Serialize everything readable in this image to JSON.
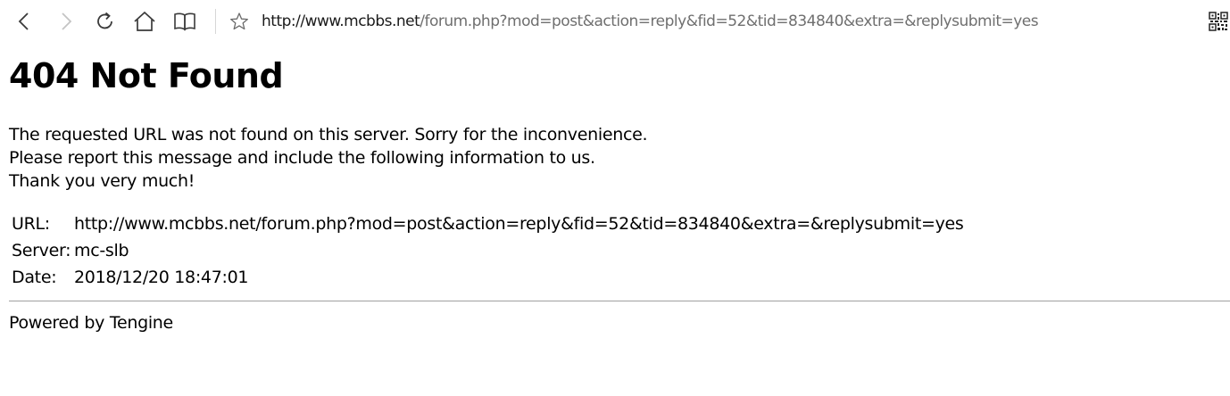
{
  "browser": {
    "address_bar": {
      "host_part": "http://www.mcbbs.net",
      "path_part": "/forum.php?mod=post&action=reply&fid=52&tid=834840&extra=&replysubmit=yes"
    },
    "icons": {
      "back": "back-arrow-icon",
      "forward": "forward-arrow-icon",
      "refresh": "refresh-icon",
      "home": "home-icon",
      "reading_view": "reading-view-book-icon",
      "favorite": "star-icon",
      "qr": "qr-code-icon"
    }
  },
  "page": {
    "heading": "404 Not Found",
    "messages": [
      "The requested URL was not found on this server. Sorry for the inconvenience.",
      "Please report this message and include the following information to us.",
      "Thank you very much!"
    ],
    "info": {
      "url_label": "URL:",
      "url_value": "http://www.mcbbs.net/forum.php?mod=post&action=reply&fid=52&tid=834840&extra=&replysubmit=yes",
      "server_label": "Server:",
      "server_value": "mc-slb",
      "date_label": "Date:",
      "date_value": "2018/12/20 18:47:01"
    },
    "footer": "Powered by Tengine"
  }
}
